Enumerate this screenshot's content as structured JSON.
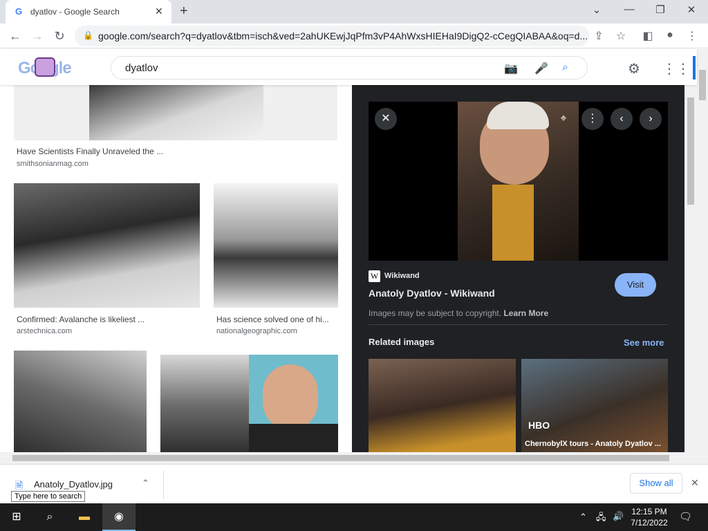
{
  "browser": {
    "tab_title": "dyatlov - Google Search",
    "tab_favicon": "G",
    "url": "google.com/search?q=dyatlov&tbm=isch&ved=2ahUKEwjJqPfm3vP4AhWxsHIEHaI9DigQ2-cCegQIABAA&oq=d..."
  },
  "google": {
    "logo_text": "Google",
    "query": "dyatlov"
  },
  "results": [
    {
      "caption": "Have Scientists Finally Unraveled the ...",
      "source": "smithsonianmag.com"
    },
    {
      "caption": "Confirmed: Avalanche is likeliest ...",
      "source": "arstechnica.com"
    },
    {
      "caption": "Has science solved one of hi...",
      "source": "nationalgeographic.com"
    }
  ],
  "panel": {
    "site_badge": "W",
    "site_name": "Wikiwand",
    "title": "Anatoly Dyatlov - Wikiwand",
    "visit_label": "Visit",
    "copyright": "Images may be subject to copyright.",
    "learn_more": "Learn More",
    "related_heading": "Related images",
    "see_more": "See more",
    "related": [
      {
        "caption": ""
      },
      {
        "caption": "ChernobylX tours - Anatoly Dyatlov ...",
        "badge": "HBO"
      }
    ]
  },
  "download": {
    "filename": "Anatoly_Dyatlov.jpg",
    "show_all": "Show all",
    "tooltip": "Type here to search"
  },
  "taskbar": {
    "time": "12:15 PM",
    "date": "7/12/2022"
  },
  "icons": {
    "back": "back-arrow-icon",
    "forward": "forward-arrow-icon",
    "reload": "reload-icon",
    "lock": "lock-icon",
    "camera": "camera-icon",
    "mic": "microphone-icon",
    "search": "search-icon",
    "gear": "gear-icon",
    "apps": "apps-grid-icon"
  },
  "colors": {
    "panel_bg": "#202124",
    "visit_button": "#8ab4f8",
    "link_blue": "#1a73e8",
    "see_more": "#8ab4f8"
  }
}
